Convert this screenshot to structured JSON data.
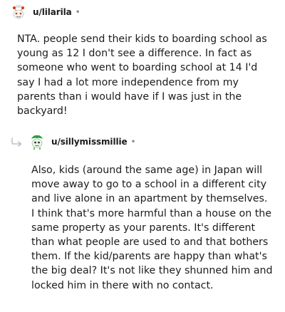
{
  "comments": [
    {
      "username": "u/lilarila",
      "separator": "•",
      "avatar_icon": "snoo-avatar-icon",
      "body": "NTA. people send their kids to boarding school as young as 12 I don't see a difference. In fact as someone who went to boarding school at 14 I'd say I had a lot more independence from my parents than i would have if I was just in the backyard!"
    },
    {
      "username": "u/sillymissmillie",
      "separator": "•",
      "avatar_icon": "snoo-avatar-icon",
      "reply_icon": "reply-arrow-icon",
      "body": "Also, kids (around the same age) in Japan will move away to go to a school in a different city and live alone in an apartment by themselves. I think that's more harmful than a house on the same property as your parents. It's different than what people are used to and that bothers them. If the kid/parents are happy than what's the big deal? It's not like they shunned him and locked him in there with no contact."
    }
  ],
  "colors": {
    "text": "#1c1c1c",
    "muted": "#8a8a8a",
    "avatar1_accent": "#d93a00",
    "avatar2_accent": "#2e9e3e"
  }
}
